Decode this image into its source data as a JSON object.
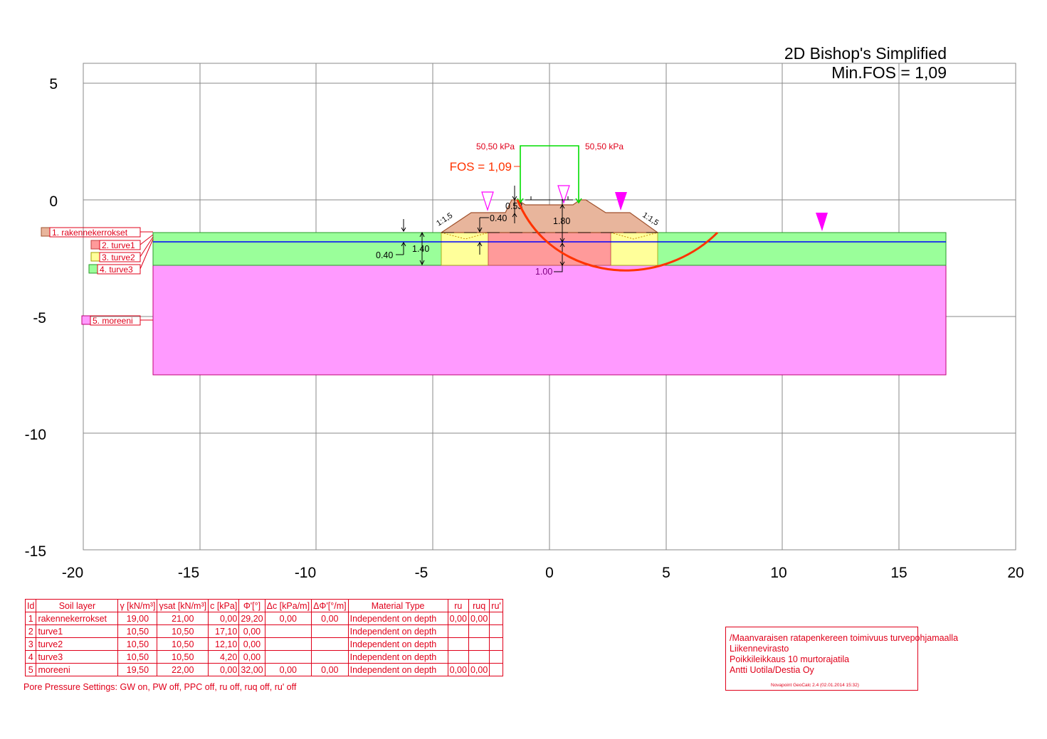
{
  "analysis": {
    "method": "2D Bishop's Simplified",
    "min_fos": "Min.FOS = 1,09",
    "fos_label": "FOS = 1,09"
  },
  "axes": {
    "x_ticks": [
      "-20",
      "-15",
      "-10",
      "-5",
      "0",
      "5",
      "10",
      "15",
      "20"
    ],
    "y_ticks": [
      "5",
      "0",
      "-5",
      "-10",
      "-15"
    ],
    "x_range": [
      -20,
      20
    ],
    "y_range": [
      -15,
      5
    ],
    "grid": true
  },
  "loads": {
    "left_label": "50,50 kPa",
    "right_label": "50,50 kPa",
    "value_kpa": 50.5
  },
  "slopes": {
    "left": "1:1,5",
    "right": "1:1,5"
  },
  "dimensions": {
    "d_040_left": "0.40",
    "d_140": "1.40",
    "d_040_top": "0.40",
    "d_053": "0.53",
    "d_180": "1.80",
    "d_100": "1.00"
  },
  "layer_legend": [
    {
      "label": "1. rakennekerrokset",
      "color": "#e8b59c"
    },
    {
      "label": "2. turve1",
      "color": "#ff9a9a"
    },
    {
      "label": "3. turve2",
      "color": "#ffff9a"
    },
    {
      "label": "4. turve3",
      "color": "#9aff9a"
    },
    {
      "label": "5. moreeni",
      "color": "#ff9aff"
    }
  ],
  "soil_table": {
    "headers": [
      "Id",
      "Soil layer",
      "γ [kN/m³]",
      "γsat [kN/m³]",
      "c [kPa]",
      "Φ'[°]",
      "Δc [kPa/m]",
      "ΔΦ'[°/m]",
      "Material Type",
      "ru",
      "ruq",
      "ru'"
    ],
    "rows": [
      [
        "1",
        "rakennekerrokset",
        "19,00",
        "21,00",
        "0,00",
        "29,20",
        "0,00",
        "0,00",
        "Independent on depth",
        "0,00",
        "0,00",
        ""
      ],
      [
        "2",
        "turve1",
        "10,50",
        "10,50",
        "17,10",
        "0,00",
        "",
        "",
        "Independent on depth",
        "",
        "",
        ""
      ],
      [
        "3",
        "turve2",
        "10,50",
        "10,50",
        "12,10",
        "0,00",
        "",
        "",
        "Independent on depth",
        "",
        "",
        ""
      ],
      [
        "4",
        "turve3",
        "10,50",
        "10,50",
        "4,20",
        "0,00",
        "",
        "",
        "Independent on depth",
        "",
        "",
        ""
      ],
      [
        "5",
        "moreeni",
        "19,50",
        "22,00",
        "0,00",
        "32,00",
        "0,00",
        "0,00",
        "Independent on depth",
        "0,00",
        "0,00",
        ""
      ]
    ]
  },
  "pore_pressure": "Pore Pressure Settings: GW on, PW off, PPC off, ru off, ruq off, ru' off",
  "title_block": {
    "line1": "/Maanvaraisen ratapenkereen toimivuus turvepohjamaalla",
    "line2": "Liikennevirasto",
    "line3": "Poikkileikkaus 10 murtorajatila",
    "line4": "Antti Uotila/Destia Oy",
    "software": "Novapoint GeoCalc 2.4  (02.01.2014 15:32)"
  },
  "colors": {
    "grid": "#8a8a8a",
    "embankment": "#e8b59c",
    "embankment_edge": "#a0522d",
    "turve1": "#ff9a9a",
    "turve2": "#ffff9a",
    "turve3": "#9aff9a",
    "moreeni": "#ff9aff",
    "groundwater": "#0000ff",
    "slip_surface": "#ff3300",
    "load": "#00dd00",
    "label_red": "#e0001a",
    "dimension": "#000000",
    "marker": "#ff00ff"
  }
}
